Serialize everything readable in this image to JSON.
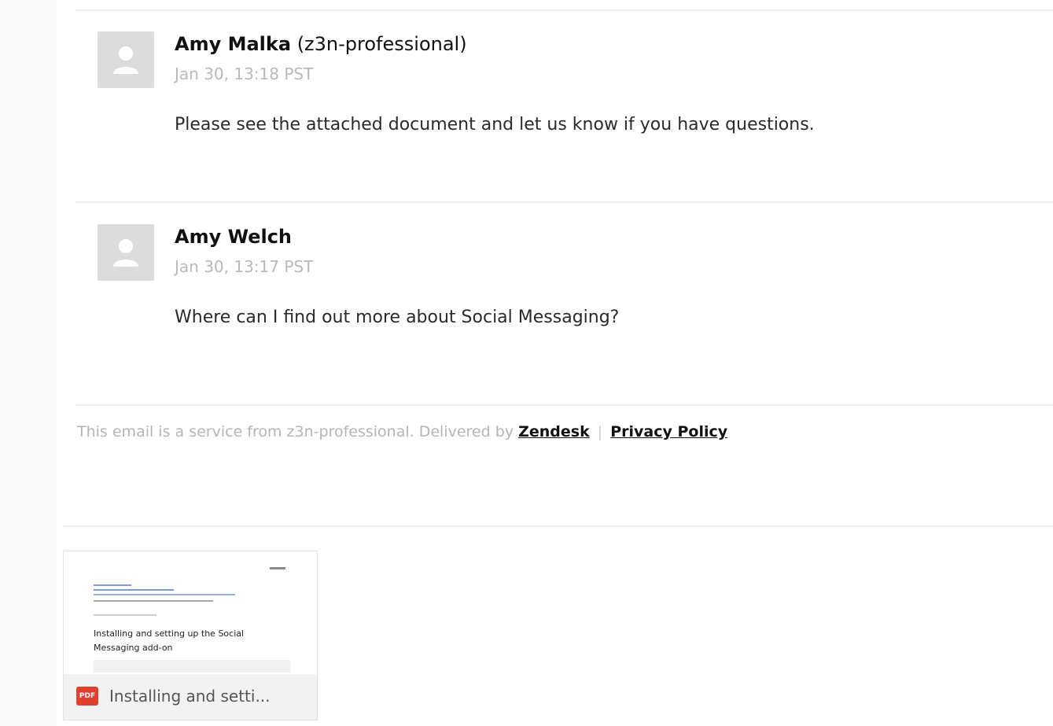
{
  "comments": [
    {
      "author_name": "Amy Malka",
      "author_org": "(z3n-professional)",
      "time": "Jan 30, 13:18 PST",
      "body": "Please see the attached document and let us know if you have questions."
    },
    {
      "author_name": "Amy Welch",
      "author_org": "",
      "time": "Jan 30, 13:17 PST",
      "body": "Where can I find out more about Social Messaging?"
    }
  ],
  "footer": {
    "prefix": "This email is a service from z3n-professional. Delivered by",
    "zendesk_link": "Zendesk",
    "separator": "|",
    "privacy_link": "Privacy Policy"
  },
  "attachment": {
    "file_type": "PDF",
    "name": "Installing and setti...",
    "preview_title": "Installing and setting up the Social Messaging add-on"
  },
  "colors": {
    "avatar_bg": "#dcdcdc",
    "pdf_red": "#e2402f",
    "muted_text": "#b9b9b9",
    "link_blue": "#3b6fc9"
  },
  "icons": {
    "avatar": "user-silhouette-icon",
    "file": "pdf-file-icon"
  }
}
